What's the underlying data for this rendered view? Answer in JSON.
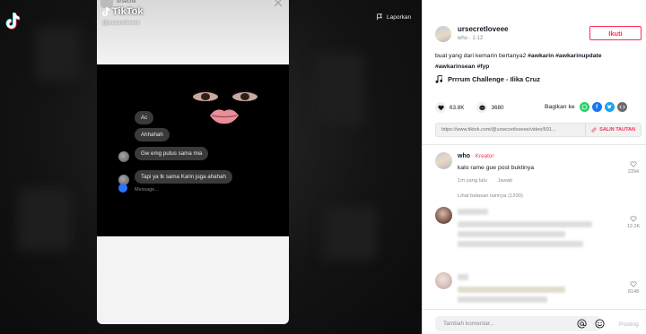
{
  "viewer": {
    "report_label": "Laporkan",
    "video": {
      "watermark_brand": "TikTok",
      "watermark_user": "@ursecretloveee",
      "top_handle": "ursecret",
      "chat_messages": [
        {
          "text": "Ac"
        },
        {
          "text": "Ahhahah"
        },
        {
          "text": "Gw emg putus sama mia"
        },
        {
          "text": "Tapi ya tk sama Karin juga ahahah"
        }
      ],
      "chat_input_placeholder": "Message..."
    }
  },
  "panel": {
    "author": {
      "name": "ursecretloveee",
      "meta": "who · 1-12",
      "follow_label": "Ikuti"
    },
    "caption": {
      "text": "buat yang dari kemarin bertanya2",
      "hashtags_line1": [
        "#awkarin",
        "#awkarinupdate"
      ],
      "hashtags_line2": [
        "#awkarinsean",
        "#fyp"
      ]
    },
    "music": "Prrrum Challenge - Ilika Cruz",
    "stats": {
      "likes": "63.8K",
      "comments": "3680",
      "share_label": "Bagikan ke"
    },
    "share_icons": [
      "whatsapp-icon",
      "facebook-icon",
      "twitter-icon",
      "embed-icon"
    ],
    "link": {
      "url": "https://www.tiktok.com/@ursecretloveee/video/691...",
      "copy_label": "SALIN TAUTAN"
    },
    "comments": [
      {
        "name": "who",
        "badge": "· Kreator",
        "text": "kalo rame gue post buktinya",
        "time": "1m yang lalu",
        "reply_label": "Jawab",
        "likes": "2394"
      },
      {
        "likes": "12.2K"
      },
      {
        "likes": "8148"
      }
    ],
    "more_replies": "Lihat balasan lainnya (1200)",
    "comment_box": {
      "placeholder": "Tambah komentar...",
      "post_label": "Posting"
    }
  },
  "colors": {
    "accent": "#fe2c55",
    "panel_bg": "#ffffff",
    "viewer_bg": "#141414"
  }
}
